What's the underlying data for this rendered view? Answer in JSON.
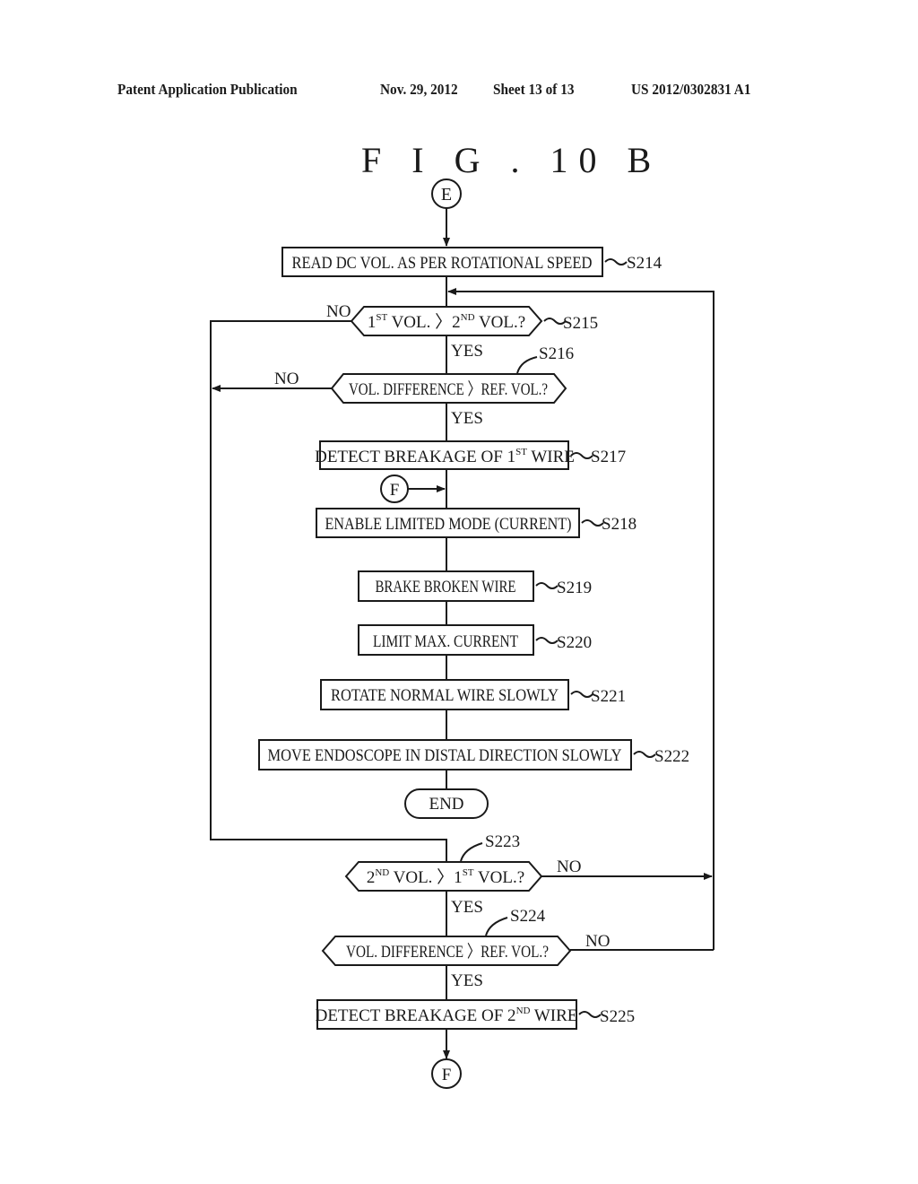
{
  "header": {
    "publication_type": "Patent Application Publication",
    "date": "Nov. 29, 2012",
    "sheet": "Sheet 13 of 13",
    "patent_number": "US 2012/0302831 A1"
  },
  "figure": {
    "title": "F I G . 10 B",
    "connectors": {
      "entry": "E",
      "f_in": "F",
      "f_out": "F"
    },
    "steps": {
      "s214": {
        "id": "S214",
        "text": "READ DC VOL. AS PER ROTATIONAL SPEED"
      },
      "s215": {
        "id": "S215",
        "a": "1",
        "a_sup": "ST",
        "mid": " VOL. 〉2",
        "b_sup": "ND",
        "end": " VOL.?"
      },
      "s216": {
        "id": "S216",
        "text": "VOL. DIFFERENCE 〉REF. VOL.?"
      },
      "s217": {
        "id": "S217",
        "pre": "DETECT BREAKAGE OF 1",
        "sup": "ST",
        "post": " WIRE"
      },
      "s218": {
        "id": "S218",
        "text": "ENABLE LIMITED MODE (CURRENT)"
      },
      "s219": {
        "id": "S219",
        "text": "BRAKE BROKEN WIRE"
      },
      "s220": {
        "id": "S220",
        "text": "LIMIT MAX. CURRENT"
      },
      "s221": {
        "id": "S221",
        "text": "ROTATE NORMAL WIRE SLOWLY"
      },
      "s222": {
        "id": "S222",
        "text": "MOVE ENDOSCOPE IN DISTAL DIRECTION SLOWLY"
      },
      "end": {
        "text": "END"
      },
      "s223": {
        "id": "S223",
        "a": "2",
        "a_sup": "ND",
        "mid": " VOL. 〉1",
        "b_sup": "ST",
        "end": " VOL.?"
      },
      "s224": {
        "id": "S224",
        "text": "VOL. DIFFERENCE 〉REF. VOL.?"
      },
      "s225": {
        "id": "S225",
        "pre": "DETECT BREAKAGE OF 2",
        "sup": "ND",
        "post": " WIRE"
      }
    },
    "branch_labels": {
      "yes": "YES",
      "no": "NO"
    }
  }
}
